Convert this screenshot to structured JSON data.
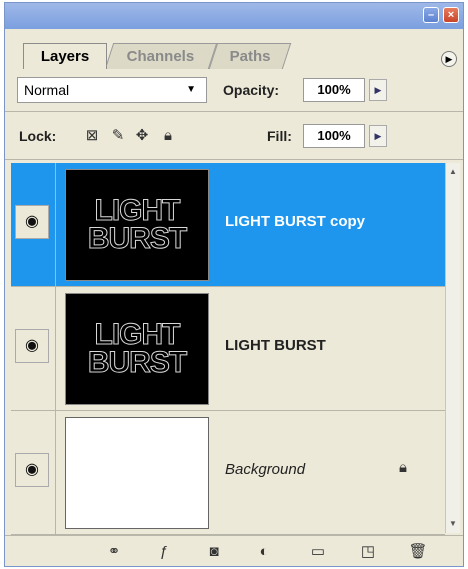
{
  "tabs": [
    {
      "label": "Layers"
    },
    {
      "label": "Channels"
    },
    {
      "label": "Paths"
    }
  ],
  "blend": {
    "mode": "Normal",
    "opacity_label": "Opacity:",
    "opacity_value": "100%"
  },
  "lock": {
    "label": "Lock:",
    "fill_label": "Fill:",
    "fill_value": "100%"
  },
  "layers": [
    {
      "name": "LIGHT BURST copy",
      "thumb_text_1": "LIGHT",
      "thumb_text_2": "BURST",
      "selected": true
    },
    {
      "name": "LIGHT BURST",
      "thumb_text_1": "LIGHT",
      "thumb_text_2": "BURST",
      "selected": false
    },
    {
      "name": "Background",
      "selected": false
    }
  ],
  "icons": {
    "link": "link-icon",
    "fx": "fx-icon",
    "mask": "mask-icon",
    "adjustment": "adjustment-icon",
    "group": "folder-icon",
    "new_layer": "new-layer-icon",
    "trash": "trash-icon"
  },
  "colors": {
    "selection": "#1e96ee",
    "panel": "#ece9d8"
  }
}
